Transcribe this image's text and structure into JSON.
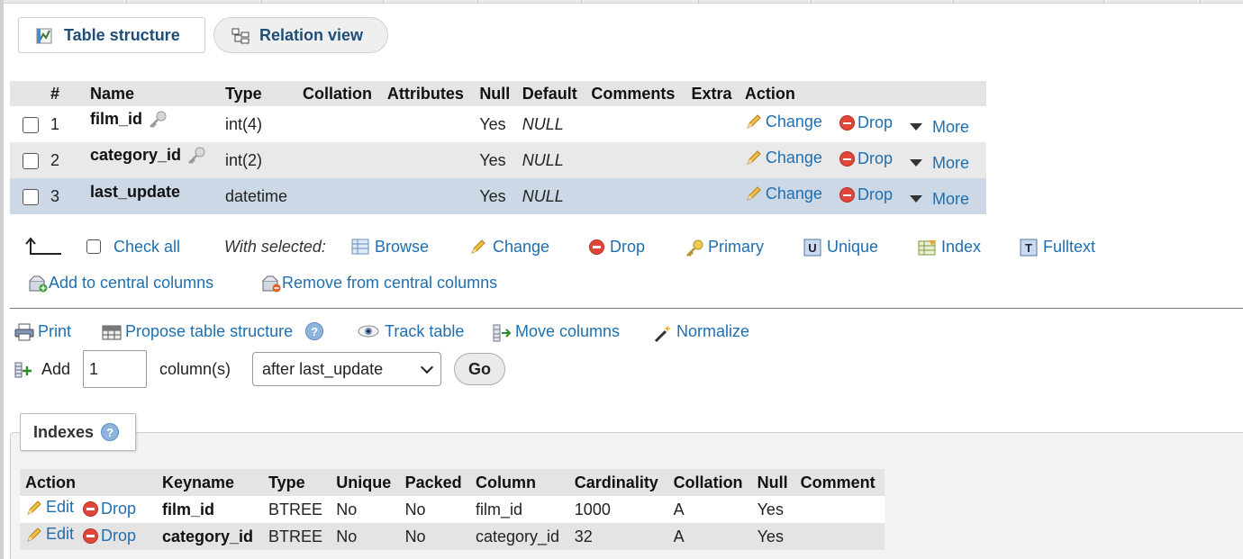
{
  "tabs": {
    "structure_label": "Table structure",
    "relation_label": "Relation view"
  },
  "columns_table": {
    "headers": [
      "#",
      "Name",
      "Type",
      "Collation",
      "Attributes",
      "Null",
      "Default",
      "Comments",
      "Extra",
      "Action"
    ],
    "rows": [
      {
        "num": "1",
        "name": "film_id",
        "type": "int(4)",
        "collation": "",
        "attributes": "",
        "null": "Yes",
        "default": "NULL",
        "comments": "",
        "extra": "",
        "is_key": true
      },
      {
        "num": "2",
        "name": "category_id",
        "type": "int(2)",
        "collation": "",
        "attributes": "",
        "null": "Yes",
        "default": "NULL",
        "comments": "",
        "extra": "",
        "is_key": true
      },
      {
        "num": "3",
        "name": "last_update",
        "type": "datetime",
        "collation": "",
        "attributes": "",
        "null": "Yes",
        "default": "NULL",
        "comments": "",
        "extra": "",
        "is_key": false
      }
    ],
    "actions": {
      "change": "Change",
      "drop": "Drop",
      "more": "More"
    }
  },
  "with_selected": {
    "check_all": "Check all",
    "label": "With selected:",
    "browse": "Browse",
    "change": "Change",
    "drop": "Drop",
    "primary": "Primary",
    "unique": "Unique",
    "index": "Index",
    "fulltext": "Fulltext",
    "add_central": "Add to central columns",
    "remove_central": "Remove from central columns"
  },
  "tools": {
    "print": "Print",
    "propose": "Propose table structure",
    "track": "Track table",
    "move": "Move columns",
    "normalize": "Normalize"
  },
  "add_column": {
    "add_label": "Add",
    "count_value": "1",
    "columns_label": "column(s)",
    "position_selected": "after last_update",
    "go_label": "Go"
  },
  "indexes": {
    "title": "Indexes",
    "headers": [
      "Action",
      "Keyname",
      "Type",
      "Unique",
      "Packed",
      "Column",
      "Cardinality",
      "Collation",
      "Null",
      "Comment"
    ],
    "edit_label": "Edit",
    "drop_label": "Drop",
    "rows": [
      {
        "keyname": "film_id",
        "type": "BTREE",
        "unique": "No",
        "packed": "No",
        "column": "film_id",
        "cardinality": "1000",
        "collation": "A",
        "null": "Yes",
        "comment": ""
      },
      {
        "keyname": "category_id",
        "type": "BTREE",
        "unique": "No",
        "packed": "No",
        "column": "category_id",
        "cardinality": "32",
        "collation": "A",
        "null": "Yes",
        "comment": ""
      }
    ]
  },
  "colors": {
    "link": "#1f6fb0",
    "tab_text": "#1f4e79",
    "header_bg": "#e4e4e4",
    "row_alt": "#e9e9e9",
    "row_highlight": "#ccd8e6",
    "drop_red": "#e0463a"
  }
}
